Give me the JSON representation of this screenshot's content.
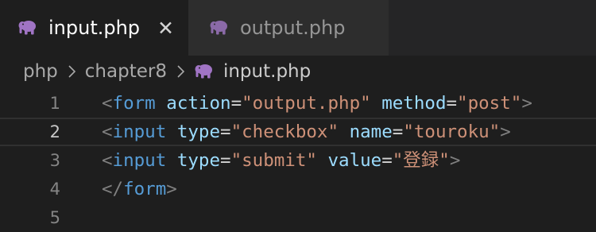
{
  "tabs": [
    {
      "label": "input.php",
      "active": true,
      "icon": "php-elephant-icon",
      "close": "✕"
    },
    {
      "label": "output.php",
      "active": false,
      "icon": "php-elephant-icon"
    }
  ],
  "breadcrumb": [
    "php",
    "chapter8",
    "input.php"
  ],
  "editor": {
    "current_line": 2,
    "line_numbers": [
      "1",
      "2",
      "3",
      "4",
      "5"
    ],
    "lines": [
      [
        {
          "t": "bracket",
          "v": "<"
        },
        {
          "t": "tag",
          "v": "form"
        },
        {
          "t": "sp",
          "v": " "
        },
        {
          "t": "attr",
          "v": "action"
        },
        {
          "t": "eq",
          "v": "="
        },
        {
          "t": "str",
          "v": "\"output.php\""
        },
        {
          "t": "sp",
          "v": " "
        },
        {
          "t": "attr",
          "v": "method"
        },
        {
          "t": "eq",
          "v": "="
        },
        {
          "t": "str",
          "v": "\"post\""
        },
        {
          "t": "bracket",
          "v": ">"
        }
      ],
      [
        {
          "t": "bracket",
          "v": "<"
        },
        {
          "t": "tag",
          "v": "input"
        },
        {
          "t": "sp",
          "v": " "
        },
        {
          "t": "attr",
          "v": "type"
        },
        {
          "t": "eq",
          "v": "="
        },
        {
          "t": "str",
          "v": "\"checkbox\""
        },
        {
          "t": "sp",
          "v": " "
        },
        {
          "t": "attr",
          "v": "name"
        },
        {
          "t": "eq",
          "v": "="
        },
        {
          "t": "str",
          "v": "\"touroku\""
        },
        {
          "t": "bracket",
          "v": ">"
        }
      ],
      [
        {
          "t": "bracket",
          "v": "<"
        },
        {
          "t": "tag",
          "v": "input"
        },
        {
          "t": "sp",
          "v": " "
        },
        {
          "t": "attr",
          "v": "type"
        },
        {
          "t": "eq",
          "v": "="
        },
        {
          "t": "str",
          "v": "\"submit\""
        },
        {
          "t": "sp",
          "v": " "
        },
        {
          "t": "attr",
          "v": "value"
        },
        {
          "t": "eq",
          "v": "="
        },
        {
          "t": "str",
          "v": "\"登録\""
        },
        {
          "t": "bracket",
          "v": ">"
        }
      ],
      [
        {
          "t": "bracket",
          "v": "</"
        },
        {
          "t": "tag",
          "v": "form"
        },
        {
          "t": "bracket",
          "v": ">"
        }
      ],
      []
    ]
  },
  "colors": {
    "editor_bg": "#1e1e1e",
    "tab_bar_bg": "#252526",
    "inactive_tab_bg": "#2d2d2d",
    "php_icon": "#a074c4",
    "tag": "#569cd6",
    "attribute": "#9cdcfe",
    "string": "#ce9178",
    "bracket": "#808080"
  }
}
